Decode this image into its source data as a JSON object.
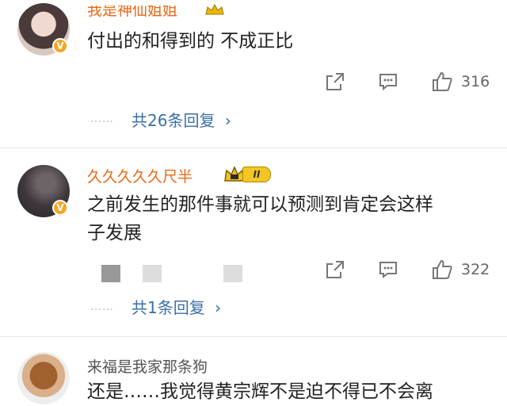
{
  "comments": [
    {
      "username": "我是神仙姐姐",
      "text": "付出的和得到的 不成正比",
      "likes": "316",
      "replies": "共26条回复",
      "verified_mark": "V"
    },
    {
      "username": "久久久久久尺半",
      "level_badge": "II",
      "text_line1": "之前发生的那件事就可以预测到肯定会这样",
      "text_line2": "子发展",
      "likes": "322",
      "replies": "共1条回复",
      "verified_mark": "V"
    },
    {
      "username": "来福是我家那条狗",
      "text_partial": "还是……我觉得黄宗辉不是迫不得已不会离"
    }
  ],
  "ui": {
    "dots": "……",
    "chevron": "›"
  },
  "colors": {
    "username": "#e86a17",
    "reply_link": "#3a6fa8",
    "badge": "#f5a623"
  },
  "icons": [
    "share-icon",
    "comment-icon",
    "like-icon",
    "crown-badge-icon",
    "chevron-right-icon"
  ]
}
